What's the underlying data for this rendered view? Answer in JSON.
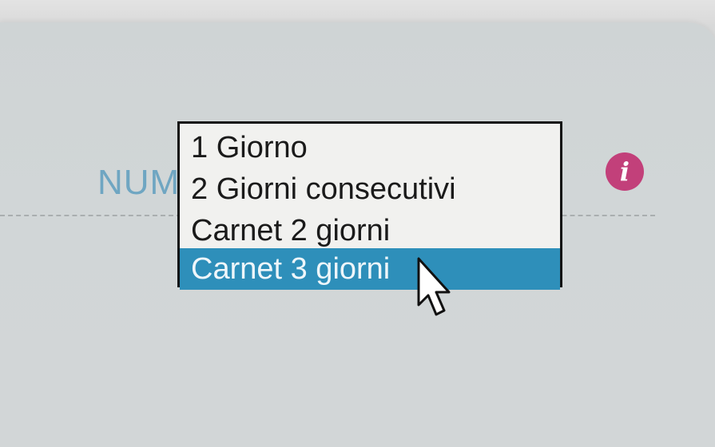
{
  "form": {
    "field_label_visible": "NUM"
  },
  "dropdown": {
    "options": [
      {
        "label": "1 Giorno"
      },
      {
        "label": "2 Giorni consecutivi"
      },
      {
        "label": "Carnet 2 giorni"
      },
      {
        "label": "Carnet 3 giorni"
      }
    ],
    "highlighted_index": 3
  },
  "info": {
    "glyph": "i",
    "icon": "info-icon",
    "color": "#c2407a"
  },
  "colors": {
    "highlight": "#2e8fba",
    "label": "#6fa6c2"
  }
}
